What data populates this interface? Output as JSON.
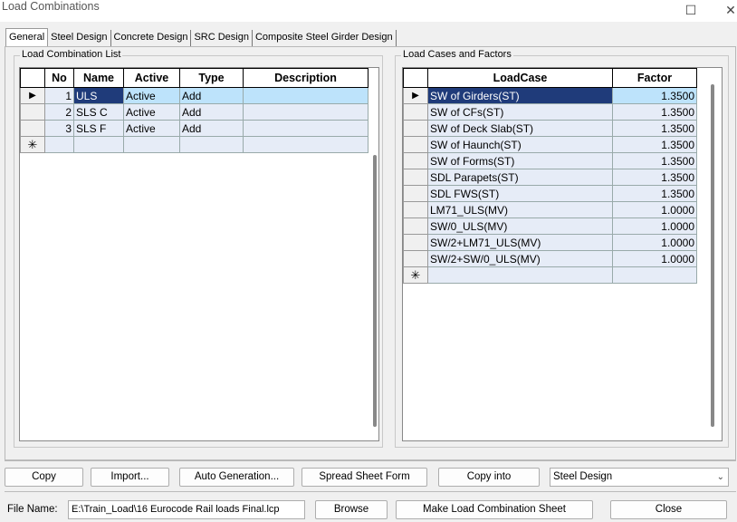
{
  "window": {
    "title": "Load Combinations"
  },
  "tabs": [
    "General",
    "Steel Design",
    "Concrete Design",
    "SRC Design",
    "Composite Steel Girder Design"
  ],
  "combo_list": {
    "title": "Load Combination List",
    "headers": [
      "No",
      "Name",
      "Active",
      "Type",
      "Description"
    ],
    "rows": [
      {
        "no": "1",
        "name": "ULS",
        "active": "Active",
        "type": "Add",
        "description": ""
      },
      {
        "no": "2",
        "name": "SLS C",
        "active": "Active",
        "type": "Add",
        "description": ""
      },
      {
        "no": "3",
        "name": "SLS F",
        "active": "Active",
        "type": "Add",
        "description": ""
      }
    ]
  },
  "cases": {
    "title": "Load Cases and Factors",
    "headers": [
      "LoadCase",
      "Factor"
    ],
    "rows": [
      {
        "loadcase": "SW of Girders(ST)",
        "factor": "1.3500"
      },
      {
        "loadcase": "SW of CFs(ST)",
        "factor": "1.3500"
      },
      {
        "loadcase": "SW of Deck Slab(ST)",
        "factor": "1.3500"
      },
      {
        "loadcase": "SW of Haunch(ST)",
        "factor": "1.3500"
      },
      {
        "loadcase": "SW of Forms(ST)",
        "factor": "1.3500"
      },
      {
        "loadcase": "SDL Parapets(ST)",
        "factor": "1.3500"
      },
      {
        "loadcase": "SDL FWS(ST)",
        "factor": "1.3500"
      },
      {
        "loadcase": "LM71_ULS(MV)",
        "factor": "1.0000"
      },
      {
        "loadcase": "SW/0_ULS(MV)",
        "factor": "1.0000"
      },
      {
        "loadcase": "SW/2+LM71_ULS(MV)",
        "factor": "1.0000"
      },
      {
        "loadcase": "SW/2+SW/0_ULS(MV)",
        "factor": "1.0000"
      }
    ]
  },
  "buttons": {
    "copy": "Copy",
    "import": "Import...",
    "auto_generation": "Auto Generation...",
    "spread_sheet": "Spread Sheet Form",
    "copy_into": "Copy into",
    "browse": "Browse",
    "make_sheet": "Make Load Combination Sheet",
    "close": "Close"
  },
  "copy_into_target": "Steel Design",
  "file": {
    "label": "File Name:",
    "value": "E:\\Train_Load\\16 Eurocode Rail loads Final.lcp"
  },
  "icons": {
    "row_pointer": "triangle-right",
    "new_row": "asterisk",
    "maximize": "square",
    "close": "x"
  }
}
